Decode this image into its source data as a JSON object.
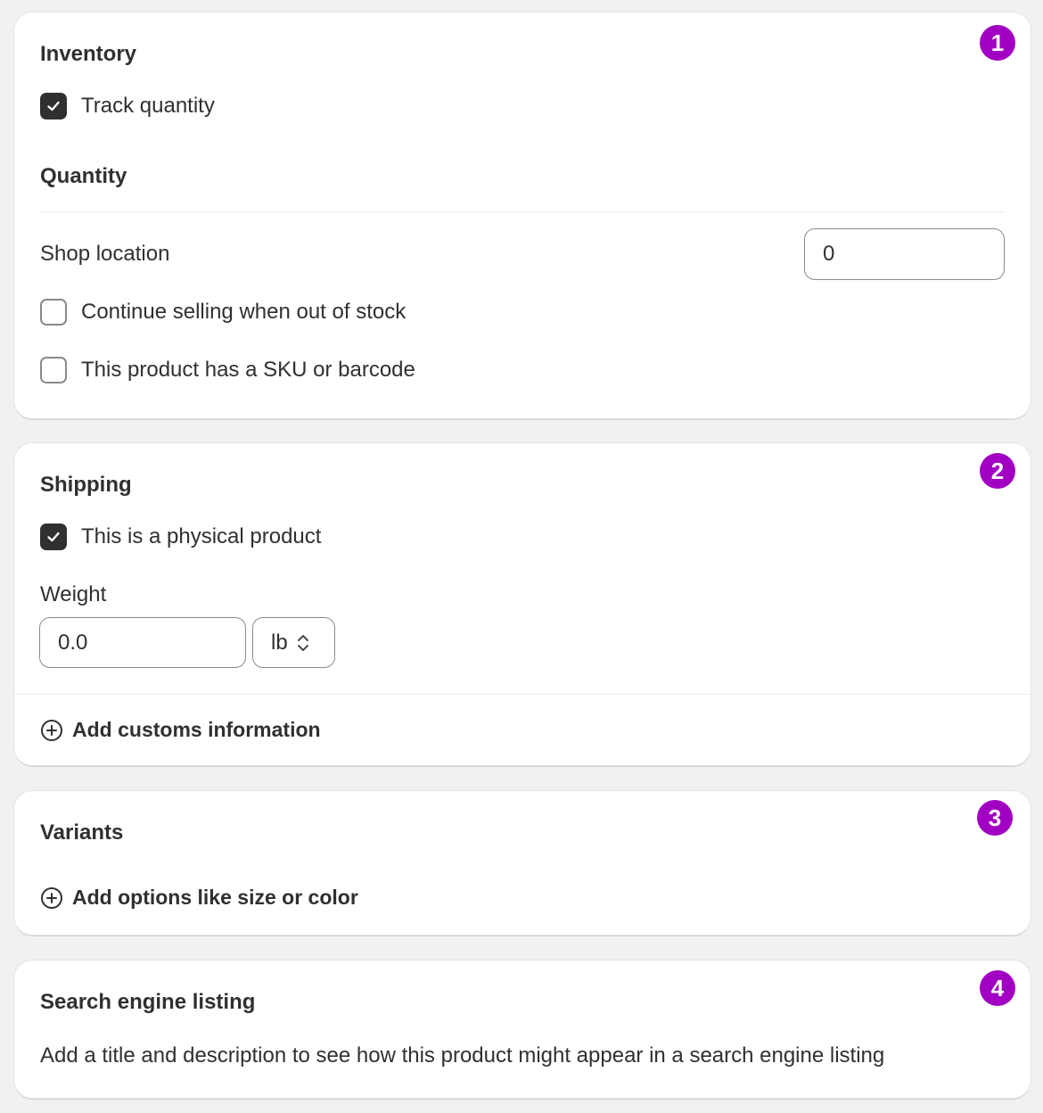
{
  "inventory": {
    "title": "Inventory",
    "badge": "1",
    "track_quantity_label": "Track quantity",
    "track_quantity_checked": true,
    "quantity_heading": "Quantity",
    "shop_location_label": "Shop location",
    "shop_location_value": "0",
    "continue_selling_label": "Continue selling when out of stock",
    "continue_selling_checked": false,
    "sku_label": "This product has a SKU or barcode",
    "sku_checked": false
  },
  "shipping": {
    "title": "Shipping",
    "badge": "2",
    "physical_label": "This is a physical product",
    "physical_checked": true,
    "weight_label": "Weight",
    "weight_value": "0.0",
    "weight_unit": "lb",
    "customs_action": "Add customs information"
  },
  "variants": {
    "title": "Variants",
    "badge": "3",
    "add_options_action": "Add options like size or color"
  },
  "seo": {
    "title": "Search engine listing",
    "badge": "4",
    "description": "Add a title and description to see how this product might appear in a search engine listing"
  },
  "colors": {
    "badge": "#a100c2",
    "checkbox_checked": "#303030",
    "background": "#f1f1f1"
  },
  "icons": [
    "checkmark-icon",
    "plus-circle-icon",
    "select-chevrons-icon"
  ]
}
